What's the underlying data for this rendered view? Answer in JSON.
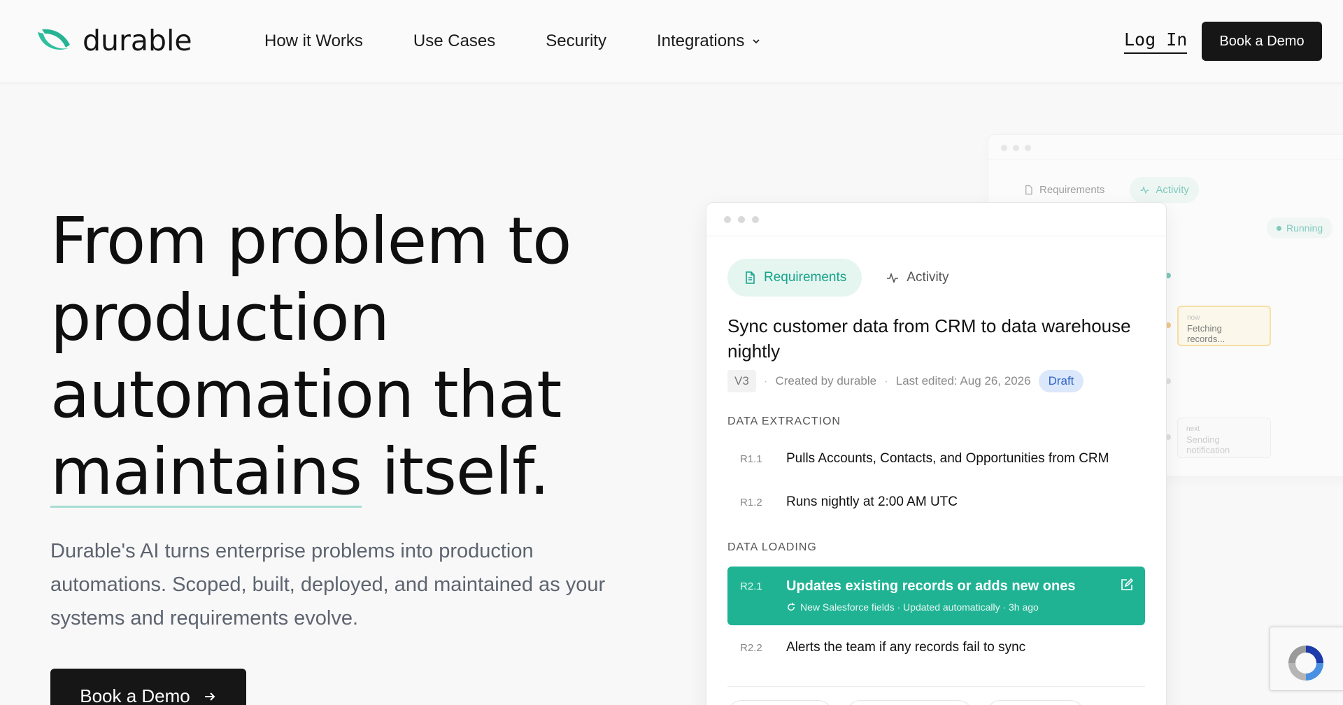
{
  "brand": {
    "name": "durable",
    "accent": "#1fb394"
  },
  "nav": {
    "items": [
      "How it Works",
      "Use Cases",
      "Security",
      "Integrations"
    ],
    "login": "Log In",
    "cta": "Book a Demo"
  },
  "hero": {
    "title_line1": "From problem to",
    "title_line2": "production",
    "title_line3": "automation that",
    "title_underlined": "maintains",
    "title_end": " itself.",
    "subtitle": "Durable's AI turns enterprise problems into production automations. Scoped, built, deployed, and maintained as your systems and requirements evolve.",
    "cta": "Book a Demo"
  },
  "back_card": {
    "tabs": [
      "Requirements",
      "Activity"
    ],
    "status": "Running",
    "now_label": "now",
    "now_text": "Fetching records...",
    "next_label": "next",
    "next_text": "Sending notification"
  },
  "card": {
    "tabs": [
      "Requirements",
      "Activity"
    ],
    "title": "Sync customer data from CRM to data warehouse nightly",
    "version": "V3",
    "created_by": "Created by durable",
    "last_edited": "Last edited: Aug 26, 2026",
    "status": "Draft",
    "sections": [
      {
        "name": "DATA EXTRACTION",
        "items": [
          {
            "id": "R1.1",
            "text": "Pulls Accounts, Contacts, and Opportunities from CRM"
          },
          {
            "id": "R1.2",
            "text": "Runs nightly at 2:00 AM UTC"
          }
        ]
      },
      {
        "name": "DATA LOADING",
        "items": [
          {
            "id": "R2.1",
            "text": "Updates existing records or adds new ones",
            "note": "New Salesforce fields · Updated automatically · 3h ago"
          },
          {
            "id": "R2.2",
            "text": "Alerts the team if any records fail to sync"
          }
        ]
      }
    ]
  }
}
